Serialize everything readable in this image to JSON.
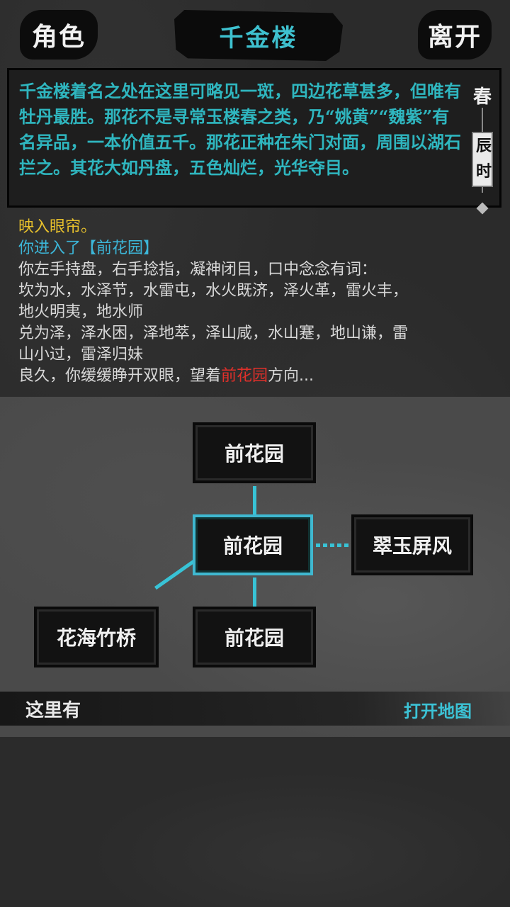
{
  "header": {
    "role_button": "角色",
    "title": "千金楼",
    "leave_button": "离开"
  },
  "description": "千金楼着名之处在这里可略见一斑，四边花草甚多，但唯有牡丹最胜。那花不是寻常玉楼春之类，乃“姚黄”“魏紫”有名异品，一本价值五千。那花正种在朱门对面，周围以湖石拦之。其花大如丹盘，五色灿烂，光华夺目。",
  "season": {
    "season": "春",
    "hour_char_1": "辰",
    "hour_char_2": "时"
  },
  "log": {
    "line1": "映入眼帘。",
    "line2_prefix": "你进入了【",
    "line2_place": "前花园",
    "line2_suffix": "】",
    "line3": "你左手持盘，右手捻指，凝神闭目，口中念念有词：",
    "line4": "坎为水，水泽节，水雷屯，水火既济，泽火革，雷火丰，",
    "line5": "地火明夷，地水师",
    "line6": "兑为泽，泽水困，泽地萃，泽山咸，水山蹇，地山谦，雷",
    "line7": "山小过，雷泽归妹",
    "line8_prefix": "良久，你缓缓睁开双眼，望着",
    "line8_place": "前花园",
    "line8_suffix": "方向..."
  },
  "map": {
    "north": "前花园",
    "current": "前花园",
    "east": "翠玉屏风",
    "southwest": "花海竹桥",
    "south": "前花园"
  },
  "bottom": {
    "here_label": "这里有",
    "open_map": "打开地图"
  },
  "colors": {
    "accent_cyan": "#3ec1cf",
    "highlight_yellow": "#e7c02c",
    "highlight_red": "#e1302a"
  }
}
